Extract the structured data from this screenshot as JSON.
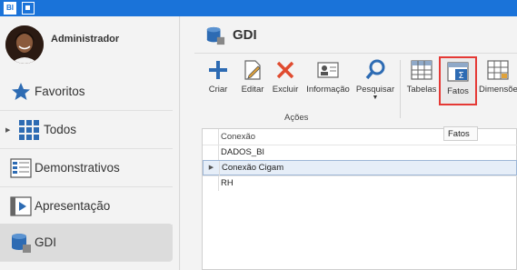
{
  "titlebar": {
    "app_icon_text": "BI"
  },
  "sidebar": {
    "user_name": "Administrador",
    "items": [
      {
        "label": "Favoritos"
      },
      {
        "label": "Todos"
      },
      {
        "label": "Demonstrativos"
      },
      {
        "label": "Apresentação"
      },
      {
        "label": "GDI"
      }
    ]
  },
  "main": {
    "title": "GDI",
    "ribbon": {
      "buttons": [
        {
          "label": "Criar"
        },
        {
          "label": "Editar"
        },
        {
          "label": "Excluir"
        },
        {
          "label": "Informação"
        },
        {
          "label": "Pesquisar"
        },
        {
          "label": "Tabelas"
        },
        {
          "label": "Fatos"
        },
        {
          "label": "Dimensões"
        }
      ],
      "group_label": "Ações",
      "tooltip": "Fatos"
    },
    "grid": {
      "column_header": "Conexão",
      "rows": [
        "DADOS_BI",
        "Conexão Cigam",
        "RH"
      ]
    }
  },
  "colors": {
    "titlebar": "#1a73d9",
    "accent": "#1a73d9",
    "highlight_border": "#e53935"
  }
}
